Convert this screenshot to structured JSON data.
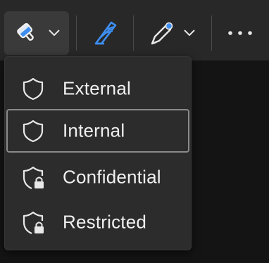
{
  "toolbar": {
    "buttons": [
      {
        "name": "format-painter",
        "icon": "paint-brush-icon",
        "has_dropdown": true,
        "active": true
      },
      {
        "name": "highlighter",
        "icon": "highlighter-pen-icon",
        "has_dropdown": false
      },
      {
        "name": "pen",
        "icon": "pen-nib-icon",
        "has_dropdown": true
      },
      {
        "name": "more",
        "icon": "more-ellipsis-icon",
        "has_dropdown": false
      }
    ],
    "accent_color": "#4a9eff"
  },
  "sensitivity_menu": {
    "items": [
      {
        "label": "External",
        "icon": "shield-icon",
        "locked": false,
        "selected": false
      },
      {
        "label": "Internal",
        "icon": "shield-icon",
        "locked": false,
        "selected": true
      },
      {
        "label": "Confidential",
        "icon": "shield-lock-icon",
        "locked": true,
        "selected": false
      },
      {
        "label": "Restricted",
        "icon": "shield-lock-icon",
        "locked": true,
        "selected": false
      }
    ]
  }
}
